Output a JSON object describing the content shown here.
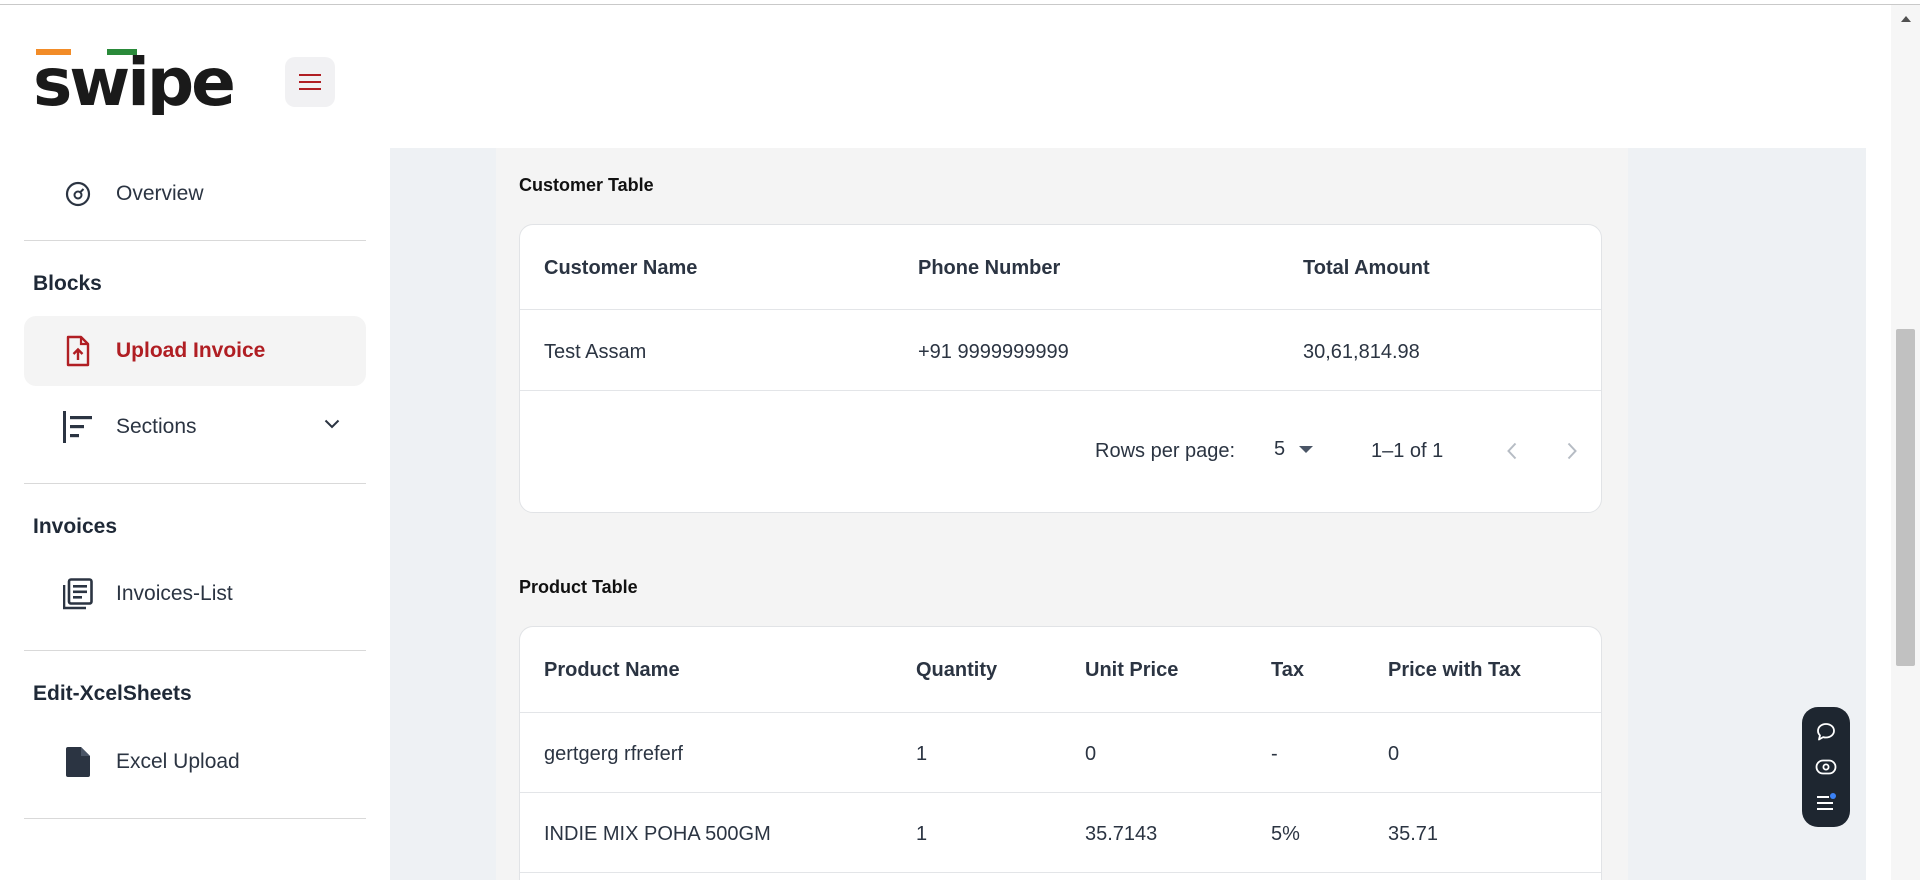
{
  "brand": {
    "logo_text": "swipe"
  },
  "sidebar": {
    "overview_label": "Overview",
    "blocks_title": "Blocks",
    "upload_invoice_label": "Upload Invoice",
    "sections_label": "Sections",
    "invoices_title": "Invoices",
    "invoices_list_label": "Invoices-List",
    "excel_title": "Edit-XcelSheets",
    "excel_upload_label": "Excel Upload"
  },
  "customer_table": {
    "title": "Customer Table",
    "headers": [
      "Customer Name",
      "Phone Number",
      "Total Amount"
    ],
    "rows": [
      {
        "name": "Test Assam",
        "phone": "+91 9999999999",
        "total": "30,61,814.98"
      }
    ],
    "pagination": {
      "rows_per_page_label": "Rows per page:",
      "rows_per_page_value": "5",
      "range": "1–1 of 1"
    }
  },
  "product_table": {
    "title": "Product Table",
    "headers": [
      "Product Name",
      "Quantity",
      "Unit Price",
      "Tax",
      "Price with Tax"
    ],
    "rows": [
      {
        "name": "gertgerg rfreferf",
        "qty": "1",
        "unit": "0",
        "tax": "-",
        "price_tax": "0"
      },
      {
        "name": "INDIE MIX POHA 500GM",
        "qty": "1",
        "unit": "35.7143",
        "tax": "5%",
        "price_tax": "35.71"
      }
    ]
  },
  "colors": {
    "accent": "#b01e23",
    "logo_orange": "#f28c28",
    "logo_green": "#2a8a3a"
  },
  "icons": [
    "menu-icon",
    "gauge-icon",
    "upload-file-icon",
    "sections-icon",
    "chevron-down-icon",
    "list-icon",
    "file-icon",
    "chat-icon",
    "eye-icon",
    "notes-icon",
    "chevron-left-icon",
    "chevron-right-icon",
    "dropdown-arrow-icon"
  ]
}
